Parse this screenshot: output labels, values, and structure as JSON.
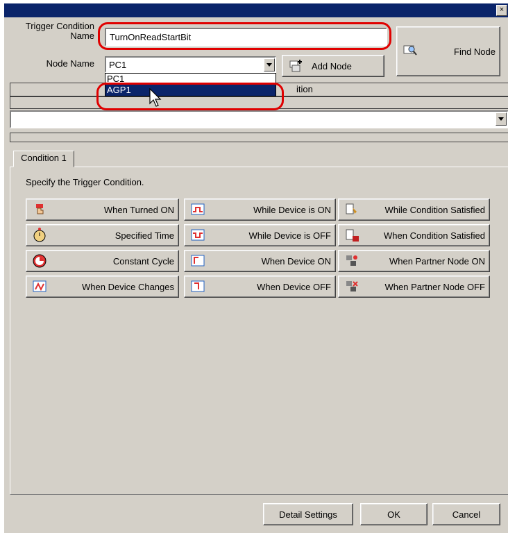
{
  "titlebar": {
    "close_glyph": "×"
  },
  "form": {
    "trigger_label": "Trigger Condition Name",
    "trigger_value": "TurnOnReadStartBit",
    "node_label": "Node Name",
    "node_value": "PC1",
    "node_options": [
      "PC1",
      "AGP1"
    ],
    "add_node": "Add Node",
    "find_node": "Find Node",
    "column_partial": "ition"
  },
  "tab": {
    "label": "Condition 1"
  },
  "instruction": "Specify the Trigger Condition.",
  "conditions": [
    {
      "label": "When Turned ON",
      "icon": "hand-press-icon"
    },
    {
      "label": "While Device is ON",
      "icon": "device-on-icon"
    },
    {
      "label": "While Condition Satisfied",
      "icon": "condition-icon"
    },
    {
      "label": "Specified Time",
      "icon": "alarm-clock-icon"
    },
    {
      "label": "While Device is OFF",
      "icon": "device-off-icon"
    },
    {
      "label": "When Condition Satisfied",
      "icon": "condition-ok-icon"
    },
    {
      "label": "Constant Cycle",
      "icon": "cycle-clock-icon"
    },
    {
      "label": "When Device ON",
      "icon": "device-rise-icon"
    },
    {
      "label": "When Partner Node ON",
      "icon": "partner-on-icon"
    },
    {
      "label": "When Device Changes",
      "icon": "device-change-icon"
    },
    {
      "label": "When Device OFF",
      "icon": "device-fall-icon"
    },
    {
      "label": "When Partner Node OFF",
      "icon": "partner-off-icon"
    }
  ],
  "footer": {
    "detail": "Detail Settings",
    "ok": "OK",
    "cancel": "Cancel"
  },
  "colors": {
    "titlebar": "#0a246a",
    "face": "#d4d0c8",
    "highlight": "#0a246a",
    "annotation": "#e00000"
  }
}
